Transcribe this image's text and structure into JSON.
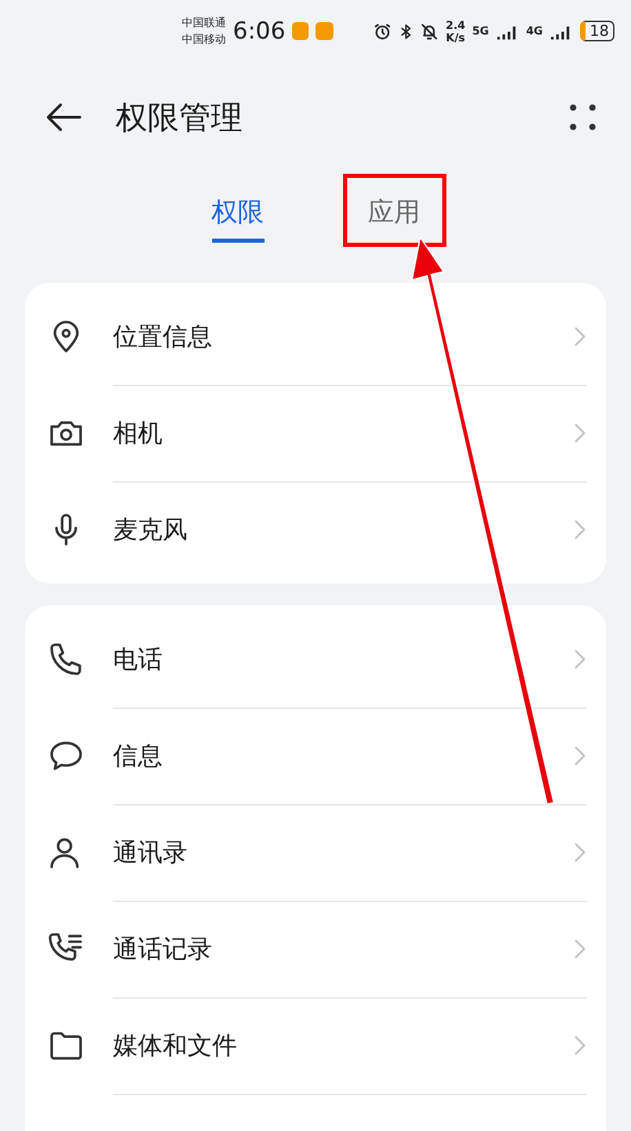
{
  "status_bar": {
    "carriers": [
      "中国联通",
      "中国移动"
    ],
    "time": "6:06",
    "speed_value": "2.4",
    "speed_unit": "K/s",
    "network_1": "5G",
    "network_2": "4G",
    "battery": "18"
  },
  "header": {
    "title": "权限管理"
  },
  "tabs": [
    {
      "label": "权限",
      "selected": true
    },
    {
      "label": "应用",
      "selected": false,
      "highlighted": true
    }
  ],
  "groups": [
    {
      "items": [
        {
          "kind": "location",
          "label": "位置信息"
        },
        {
          "kind": "camera",
          "label": "相机"
        },
        {
          "kind": "microphone",
          "label": "麦克风"
        }
      ]
    },
    {
      "items": [
        {
          "kind": "phone",
          "label": "电话"
        },
        {
          "kind": "message",
          "label": "信息"
        },
        {
          "kind": "contacts",
          "label": "通讯录"
        },
        {
          "kind": "calllog",
          "label": "通话记录"
        },
        {
          "kind": "folder",
          "label": "媒体和文件"
        }
      ],
      "continues": true
    }
  ]
}
